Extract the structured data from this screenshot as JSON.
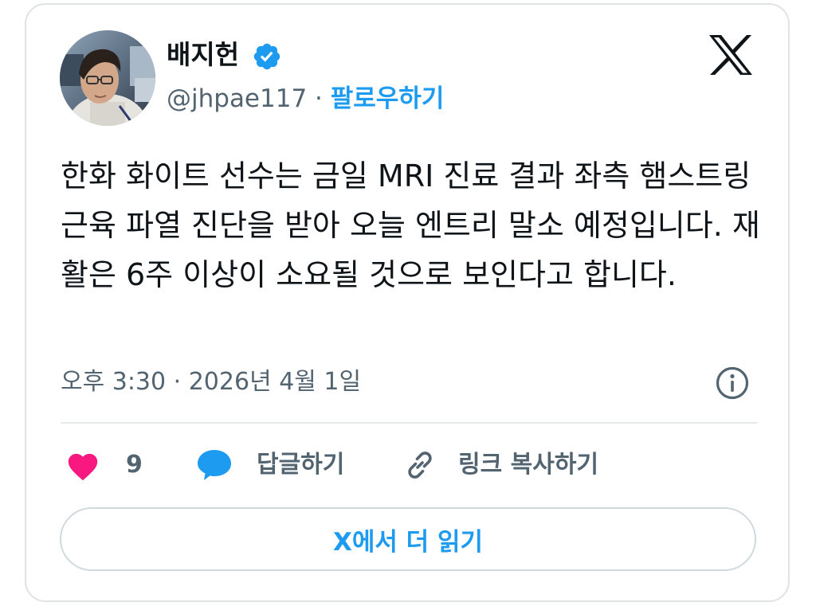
{
  "author": {
    "display_name": "배지헌",
    "handle": "@jhpae117",
    "separator": " · ",
    "follow_label": "팔로우하기",
    "verified": true
  },
  "tweet": {
    "text": "한화 화이트 선수는 금일 MRI 진료 결과 좌측 햄스트링 근육 파열 진단을 받아 오늘 엔트리 말소 예정입니다. 재활은 6주 이상이 소요될 것으로 보인다고 합니다.",
    "time": "오후 3:30",
    "separator": " · ",
    "date": "2026년 4월 1일"
  },
  "actions": {
    "like_count": "9",
    "reply_label": "답글하기",
    "copy_link_label": "링크 복사하기"
  },
  "read_more_label": "X에서 더 읽기",
  "icons": {
    "logo": "x-logo-icon",
    "verified": "verified-badge-icon",
    "info": "info-icon",
    "like": "heart-icon",
    "reply": "speech-bubble-icon",
    "copy": "link-icon"
  },
  "colors": {
    "accent": "#1d9bf0",
    "like": "#f91880",
    "secondary_text": "#536471",
    "primary_text": "#0f1419"
  }
}
